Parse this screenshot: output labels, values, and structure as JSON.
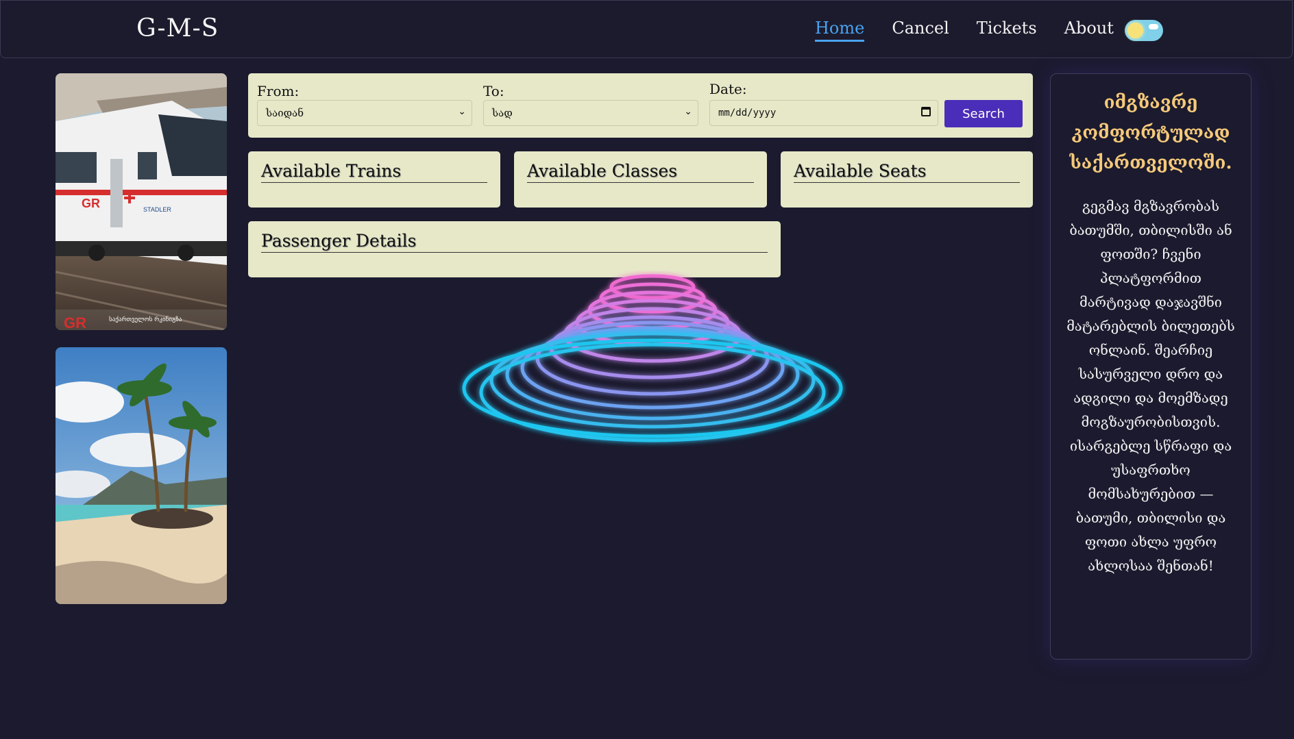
{
  "navbar": {
    "logo": "G-M-S",
    "links": [
      {
        "label": "Home",
        "active": true
      },
      {
        "label": "Cancel",
        "active": false
      },
      {
        "label": "Tickets",
        "active": false
      },
      {
        "label": "About",
        "active": false
      }
    ],
    "theme_toggle_icon": "sun-icon"
  },
  "images": {
    "train_caption": "საქართველოს რკინიგზა",
    "train_brand": "GR",
    "train_maker": "STADLER"
  },
  "search_form": {
    "from_label": "From:",
    "from_value": "საიდან",
    "to_label": "To:",
    "to_value": "სად",
    "date_label": "Date:",
    "date_placeholder": "mm/dd/yyyy",
    "search_label": "Search"
  },
  "panels": {
    "trains": "Available Trains",
    "classes": "Available Classes",
    "seats": "Available Seats",
    "passenger": "Passenger Details"
  },
  "promo": {
    "title": "იმგზავრე კომფორტულად საქართველოში.",
    "text": "გეგმავ მგზავრობას ბათუმში, თბილისში ან ფოთში? ჩვენი პლატფორმით მარტივად დაჯავშნი მატარებლის ბილეთებს ონლაინ. შეარჩიე სასურველი დრო და ადგილი და მოემზადე მოგზაურობისთვის. ისარგებლე სწრაფი და უსაფრთხო მომსახურებით — ბათუმი, თბილისი და ფოთი ახლა უფრო ახლოსაა შენთან!"
  },
  "colors": {
    "background": "#1b1a2e",
    "accent": "#4aa3f0",
    "card": "#e6e8c8",
    "button": "#4a2db8",
    "promo_title": "#f5c97a"
  }
}
